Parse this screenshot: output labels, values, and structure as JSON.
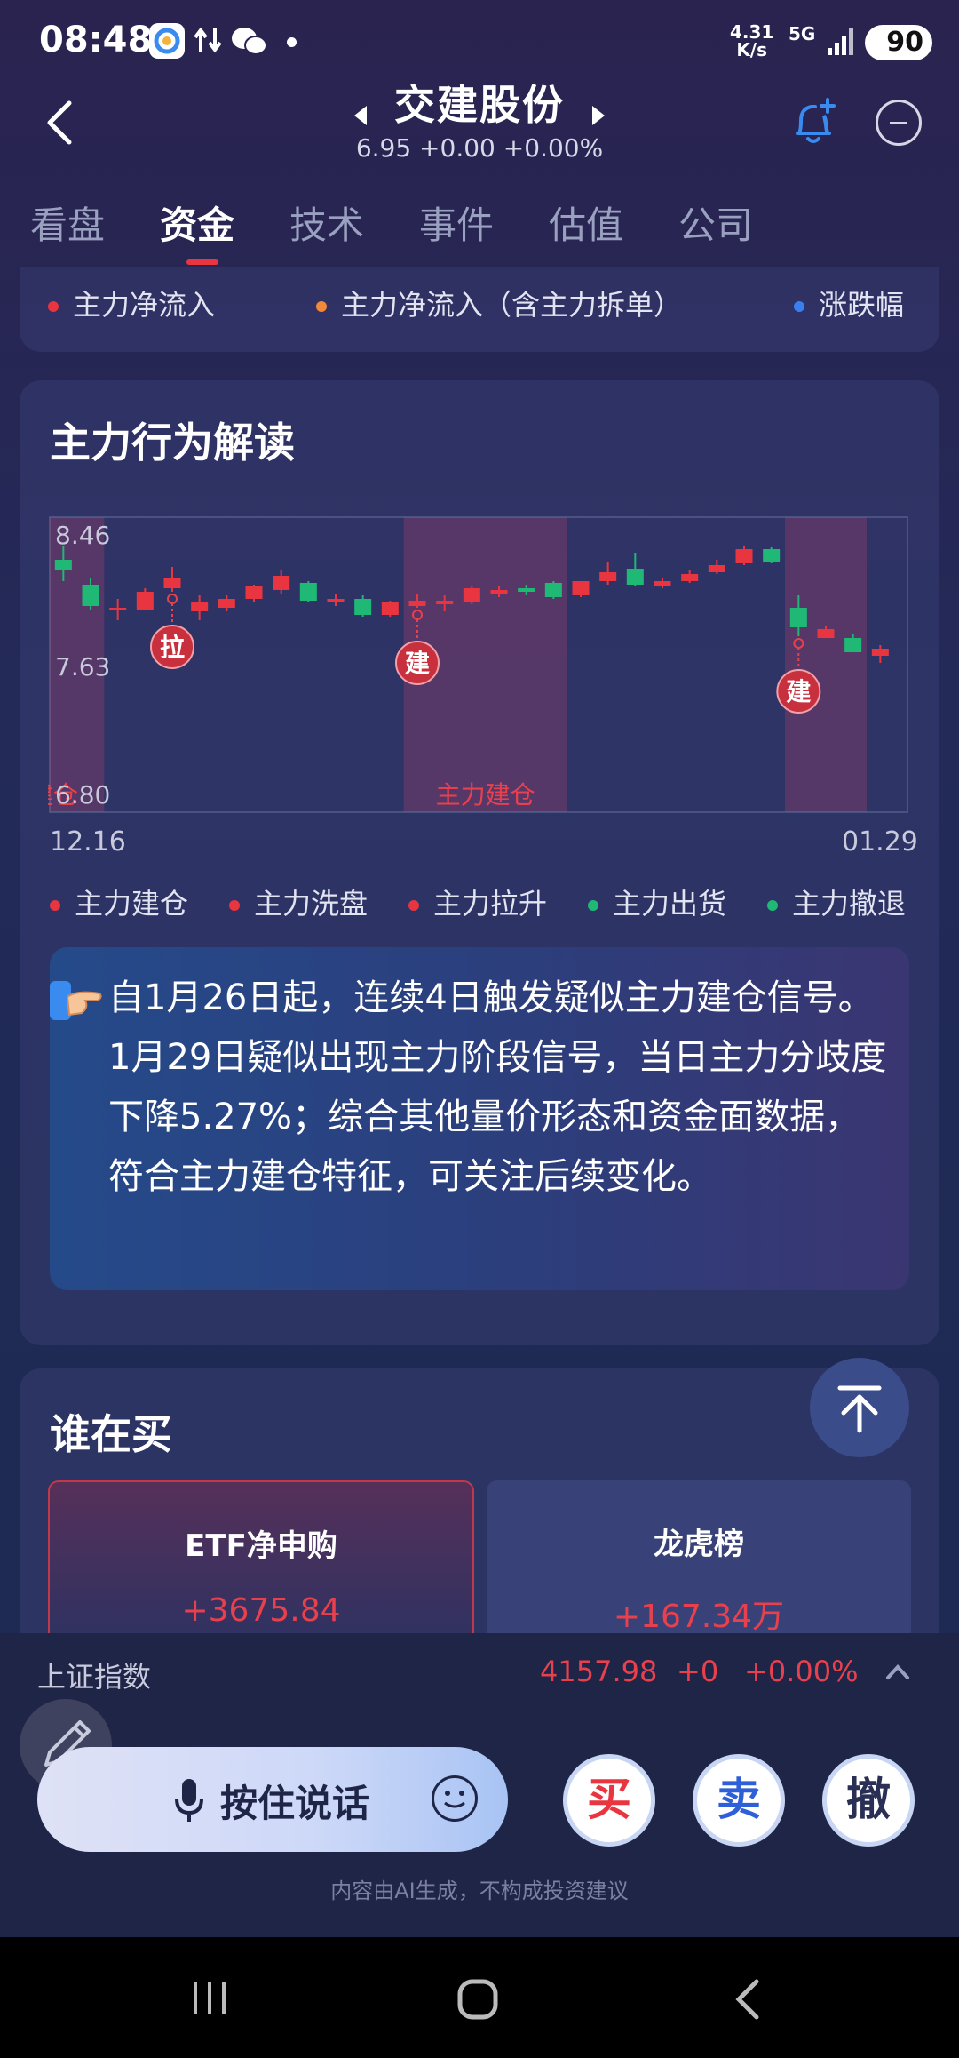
{
  "status_bar": {
    "time": "08:48",
    "net_speed_value": "4.31",
    "net_speed_unit": "K/s",
    "signal": "5G",
    "battery": "90"
  },
  "header": {
    "stock_name": "交建股份",
    "quote": "6.95 +0.00 +0.00%",
    "icons": [
      "back-arrow-icon",
      "prev-stock-icon",
      "next-stock-icon",
      "bell-plus-icon",
      "minus-circle-icon"
    ]
  },
  "tabs": [
    {
      "label": "看盘",
      "active": false
    },
    {
      "label": "资金",
      "active": true
    },
    {
      "label": "技术",
      "active": false
    },
    {
      "label": "事件",
      "active": false
    },
    {
      "label": "估值",
      "active": false
    },
    {
      "label": "公司",
      "active": false
    }
  ],
  "top_legend": [
    {
      "label": "主力净流入",
      "color": "#e8353f"
    },
    {
      "label": "主力净流入（含主力拆单）",
      "color": "#f08a3a"
    },
    {
      "label": "涨跌幅",
      "color": "#3a7ff0"
    }
  ],
  "behavior": {
    "title": "主力行为解读",
    "legend": [
      {
        "label": "主力建仓",
        "color": "#e8353f"
      },
      {
        "label": "主力洗盘",
        "color": "#e8353f"
      },
      {
        "label": "主力拉升",
        "color": "#e8353f"
      },
      {
        "label": "主力出货",
        "color": "#1fb874"
      },
      {
        "label": "主力撤退",
        "color": "#1fb874"
      }
    ],
    "insight_text": "自1月26日起，连续4日触发疑似主力建仓信号。1月29日疑似出现主力阶段信号，当日主力分歧度下降5.27%；综合其他量价形态和资金面数据，符合主力建仓特征，可关注后续变化。"
  },
  "chart_data": {
    "type": "candlestick",
    "ylim": [
      6.8,
      8.46
    ],
    "y_ticks": [
      "8.46",
      "7.63",
      "6.80"
    ],
    "x_start_label": "12.16",
    "x_end_label": "01.29",
    "zone_label": "主力建仓",
    "zone_label_cut": "建仓",
    "up_color": "#e8353f",
    "down_color": "#1fb874",
    "candles": [
      {
        "o": 8.22,
        "c": 8.16,
        "h": 8.3,
        "l": 8.1
      },
      {
        "o": 8.08,
        "c": 7.96,
        "h": 8.12,
        "l": 7.94
      },
      {
        "o": 7.95,
        "c": 7.95,
        "h": 8.0,
        "l": 7.88
      },
      {
        "o": 7.94,
        "c": 8.04,
        "h": 8.06,
        "l": 7.94
      },
      {
        "o": 8.06,
        "c": 8.12,
        "h": 8.18,
        "l": 8.04
      },
      {
        "o": 7.93,
        "c": 7.98,
        "h": 8.02,
        "l": 7.88
      },
      {
        "o": 7.95,
        "c": 8.0,
        "h": 8.02,
        "l": 7.93
      },
      {
        "o": 8.0,
        "c": 8.07,
        "h": 8.08,
        "l": 7.98
      },
      {
        "o": 8.05,
        "c": 8.13,
        "h": 8.16,
        "l": 8.03
      },
      {
        "o": 8.09,
        "c": 7.99,
        "h": 8.1,
        "l": 7.98
      },
      {
        "o": 7.98,
        "c": 8.0,
        "h": 8.03,
        "l": 7.96
      },
      {
        "o": 8.0,
        "c": 7.91,
        "h": 8.02,
        "l": 7.9
      },
      {
        "o": 7.91,
        "c": 7.98,
        "h": 7.99,
        "l": 7.9
      },
      {
        "o": 7.96,
        "c": 7.99,
        "h": 8.03,
        "l": 7.95
      },
      {
        "o": 7.97,
        "c": 7.99,
        "h": 8.02,
        "l": 7.93
      },
      {
        "o": 7.98,
        "c": 8.06,
        "h": 8.07,
        "l": 7.97
      },
      {
        "o": 8.03,
        "c": 8.05,
        "h": 8.07,
        "l": 8.01
      },
      {
        "o": 8.06,
        "c": 8.04,
        "h": 8.08,
        "l": 8.02
      },
      {
        "o": 8.09,
        "c": 8.01,
        "h": 8.1,
        "l": 8.0
      },
      {
        "o": 8.02,
        "c": 8.1,
        "h": 8.1,
        "l": 8.01
      },
      {
        "o": 8.1,
        "c": 8.15,
        "h": 8.21,
        "l": 8.08
      },
      {
        "o": 8.17,
        "c": 8.08,
        "h": 8.26,
        "l": 8.07
      },
      {
        "o": 8.07,
        "c": 8.1,
        "h": 8.12,
        "l": 8.06
      },
      {
        "o": 8.1,
        "c": 8.14,
        "h": 8.16,
        "l": 8.09
      },
      {
        "o": 8.15,
        "c": 8.19,
        "h": 8.22,
        "l": 8.14
      },
      {
        "o": 8.2,
        "c": 8.28,
        "h": 8.3,
        "l": 8.19
      },
      {
        "o": 8.28,
        "c": 8.21,
        "h": 8.29,
        "l": 8.2
      },
      {
        "o": 7.95,
        "c": 7.84,
        "h": 8.02,
        "l": 7.79
      },
      {
        "o": 7.78,
        "c": 7.83,
        "h": 7.85,
        "l": 7.78
      },
      {
        "o": 7.78,
        "c": 7.7,
        "h": 7.8,
        "l": 7.7
      },
      {
        "o": 7.68,
        "c": 7.72,
        "h": 7.74,
        "l": 7.64
      }
    ],
    "zones": [
      {
        "from": 0,
        "to": 1,
        "label": ""
      },
      {
        "from": 13,
        "to": 18,
        "label": "主力建仓"
      },
      {
        "from": 27,
        "to": 29,
        "label": ""
      }
    ],
    "markers": [
      {
        "index": 4,
        "label": "拉"
      },
      {
        "index": 13,
        "label": "建"
      },
      {
        "index": 27,
        "label": "建"
      }
    ]
  },
  "who_buys": {
    "title": "谁在买",
    "items": [
      {
        "label": "ETF净申购",
        "value": "+3675.84"
      },
      {
        "label": "龙虎榜",
        "value": "+167.34万"
      }
    ]
  },
  "index_bar": {
    "name": "上证指数",
    "value": "4157.98",
    "change": "+0",
    "pct": "+0.00%"
  },
  "actions": {
    "voice_label": "按住说话",
    "buy": "买",
    "sell": "卖",
    "cancel": "撤",
    "disclaimer": "内容由AI生成，不构成投资建议"
  }
}
